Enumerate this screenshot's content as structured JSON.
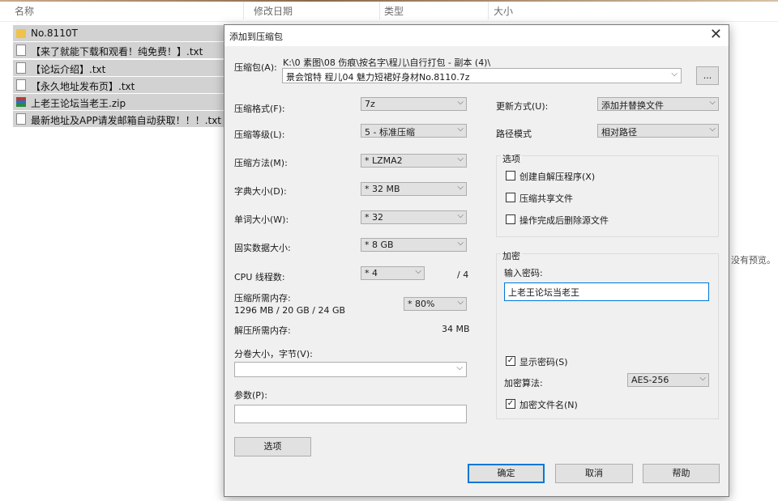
{
  "explorer": {
    "columns": [
      "名称",
      "修改日期",
      "类型",
      "大小"
    ],
    "files": [
      {
        "name": "No.8110T",
        "icon": "folder-icon"
      },
      {
        "name": "【来了就能下载和观看！纯免费！】.txt",
        "icon": "text-file-icon"
      },
      {
        "name": "【论坛介绍】.txt",
        "icon": "text-file-icon"
      },
      {
        "name": "【永久地址发布页】.txt",
        "icon": "text-file-icon"
      },
      {
        "name": "上老王论坛当老王.zip",
        "icon": "archive-icon"
      },
      {
        "name": "最新地址及APP请发邮箱自动获取！！！.txt",
        "icon": "text-file-icon"
      }
    ],
    "preview_text": "没有预览。"
  },
  "dialog": {
    "title": "添加到压缩包",
    "close_glyph": "✕",
    "archive_label": "压缩包(A):",
    "archive_path": "K:\\0 素图\\08 伤痕\\按名字\\程儿\\自行打包 - 副本 (4)\\",
    "archive_name": "景会馆特 程儿04 魅力短裙好身材No.8110.7z",
    "browse_label": "...",
    "format_label": "压缩格式(F):",
    "format_value": "7z",
    "level_label": "压缩等级(L):",
    "level_value": "5 - 标准压缩",
    "method_label": "压缩方法(M):",
    "method_value": "* LZMA2",
    "dict_label": "字典大小(D):",
    "dict_value": "* 32 MB",
    "word_label": "单词大小(W):",
    "word_value": "* 32",
    "solid_label": "固实数据大小:",
    "solid_value": "* 8 GB",
    "cpu_label": "CPU 线程数:",
    "cpu_value": "* 4",
    "cpu_total": "/ 4",
    "mem_label": "压缩所需内存:",
    "mem_detail": "1296 MB / 20 GB / 24 GB",
    "mem_value": "* 80%",
    "decomp_label": "解压所需内存:",
    "decomp_value": "34 MB",
    "split_label": "分卷大小，字节(V):",
    "split_value": "",
    "params_label": "参数(P):",
    "params_value": "",
    "options_button": "选项",
    "update_label": "更新方式(U):",
    "update_value": "添加并替换文件",
    "path_label": "路径模式",
    "path_value": "相对路径",
    "options_group": "选项",
    "opt_sfx": "创建自解压程序(X)",
    "opt_shared": "压缩共享文件",
    "opt_delete": "操作完成后删除源文件",
    "encrypt_group": "加密",
    "password_label": "输入密码:",
    "password_value": "上老王论坛当老王",
    "show_password": "显示密码(S)",
    "show_password_checked": true,
    "enc_method_label": "加密算法:",
    "enc_method_value": "AES-256",
    "encrypt_names": "加密文件名(N)",
    "encrypt_names_checked": true,
    "ok": "确定",
    "cancel": "取消",
    "help": "帮助",
    "check_glyph": "✓",
    "dropdown_glyph": "⌵"
  }
}
